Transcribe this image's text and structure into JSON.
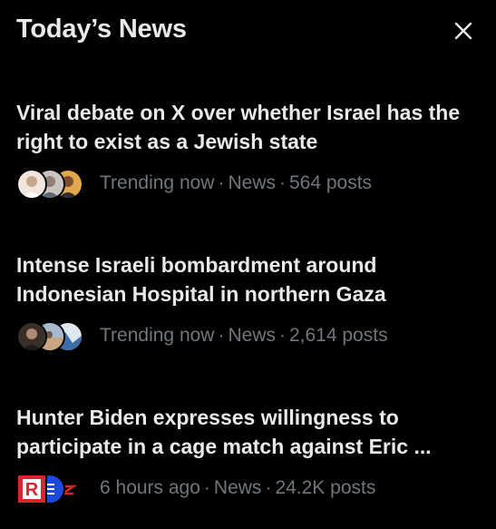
{
  "header": {
    "title": "Today’s News",
    "close_icon": "close-icon"
  },
  "news": [
    {
      "headline": "Viral debate on X over whether Israel has the right to exist as a Jewish state",
      "time": "Trending now",
      "category": "News",
      "posts": "564 posts",
      "avatar_colors": [
        "#f1e6de",
        "#c9c4c2",
        "#e2a74d"
      ]
    },
    {
      "headline": "Intense Israeli bombardment around Indonesian Hospital in northern Gaza",
      "time": "Trending now",
      "category": "News",
      "posts": "2,614 posts",
      "avatar_colors": [
        "#3a2e28",
        "#a7b9cf",
        "#3a6fa8"
      ]
    },
    {
      "headline": "Hunter Biden expresses willingness to participate in a cage match against Eric ...",
      "time": "6 hours ago",
      "category": "News",
      "posts": "24.2K posts",
      "avatar_colors": [
        "#d7262c",
        "#1d49d8",
        "#ffffff"
      ],
      "avatar_logo_text": "R"
    }
  ]
}
